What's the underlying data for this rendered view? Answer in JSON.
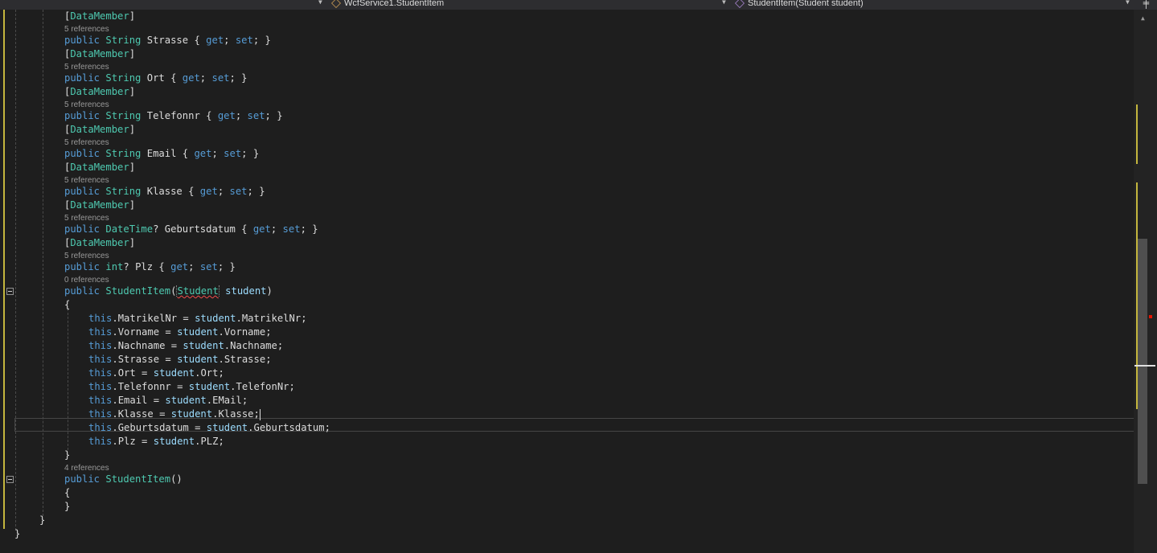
{
  "navbar": {
    "member_dropdown": "WcfService1.StudentItem",
    "method_dropdown": "StudentItem(Student student)",
    "split_icon": "split-window-icon"
  },
  "codelens": {
    "five_refs": "5 references",
    "zero_refs": "0 references",
    "four_refs": "4 references"
  },
  "code": {
    "attr_open": "[",
    "attr_name": "DataMember",
    "attr_close": "]",
    "kw_public": "public",
    "kw_this": "this",
    "type_string": "String",
    "type_datetime": "DateTime",
    "type_int": "int",
    "accessor_get": "get",
    "accessor_set": "set",
    "class_name": "StudentItem",
    "param_type": "Student",
    "param_name": "student",
    "props": [
      "Strasse",
      "Ort",
      "Telefonnr",
      "Email",
      "Klasse",
      "Geburtsdatum",
      "Plz"
    ],
    "assignments": [
      {
        "target": "MatrikelNr",
        "source": "MatrikelNr"
      },
      {
        "target": "Vorname",
        "source": "Vorname"
      },
      {
        "target": "Nachname",
        "source": "Nachname"
      },
      {
        "target": "Strasse",
        "source": "Strasse"
      },
      {
        "target": "Ort",
        "source": "Ort"
      },
      {
        "target": "Telefonnr",
        "source": "TelefonNr"
      },
      {
        "target": "Email",
        "source": "EMail"
      },
      {
        "target": "Klasse",
        "source": "Klasse"
      },
      {
        "target": "Geburtsdatum",
        "source": "Geburtsdatum"
      },
      {
        "target": "Plz",
        "source": "PLZ"
      }
    ]
  },
  "colors": {
    "background": "#1e1e1e",
    "keyword": "#569cd6",
    "type": "#4ec9b0",
    "variable": "#9cdcfe",
    "text": "#dcdcdc",
    "codelens": "#999999",
    "change_marker": "#c4b63d",
    "error_marker": "#e51400"
  }
}
